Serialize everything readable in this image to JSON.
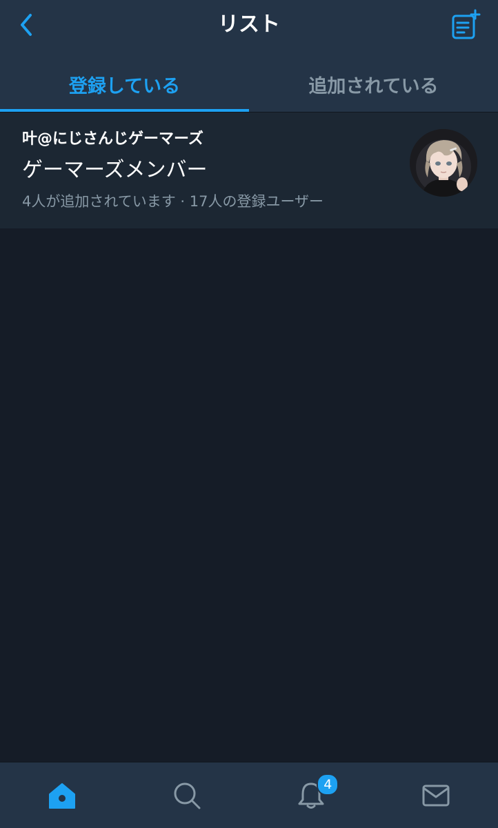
{
  "header": {
    "title": "リスト",
    "back_icon": "chevron-left-icon",
    "compose_icon": "new-list-icon"
  },
  "tabs": [
    {
      "label": "登録している",
      "active": true
    },
    {
      "label": "追加されている",
      "active": false
    }
  ],
  "lists": [
    {
      "owner": "叶@にじさんじゲーマーズ",
      "name": "ゲーマーズメンバー",
      "meta": "4人が追加されています · 17人の登録ユーザー",
      "avatar_icon": "anime-character-avatar"
    }
  ],
  "bottom_nav": {
    "home_icon": "home-icon",
    "search_icon": "search-icon",
    "notifications_icon": "bell-icon",
    "notifications_badge": "4",
    "messages_icon": "mail-icon"
  },
  "colors": {
    "accent": "#1da1f2",
    "header_bg": "#243447",
    "page_bg": "#151c27",
    "secondary_text": "#8899a6"
  }
}
